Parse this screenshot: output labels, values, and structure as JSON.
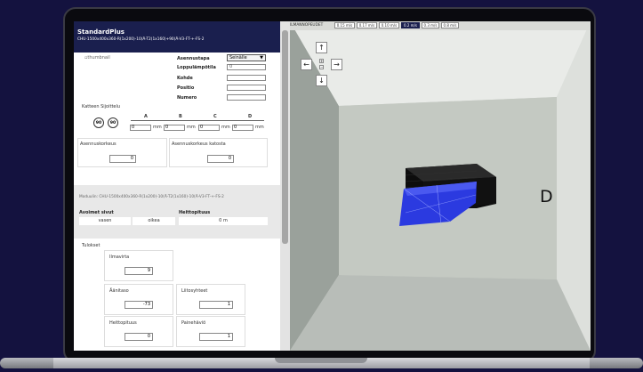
{
  "header": {
    "title": "StandardPlus",
    "product_code": "CHU-1500x400x360-R(1x200)-10(Ā-T2(1x160)+90(Ā-V3-FT-+-FS-2"
  },
  "thumbnail_alt": "thumbnail",
  "form": {
    "mounting_label": "Asennustapa",
    "mounting_value": "Seinälle",
    "final_temp_label": "Loppulämpötila",
    "final_temp_value": "0",
    "target_label": "Kohde",
    "position_label": "Positio",
    "number_label": "Numero"
  },
  "ceiling_distances_label": "Katteen Sijoittelu",
  "rotate_left_label": "90",
  "rotate_right_label": "90",
  "columns": [
    "A",
    "B",
    "C",
    "D"
  ],
  "mm_values": [
    "0",
    "0",
    "0",
    "0"
  ],
  "unit_mm": "mm",
  "install_height": {
    "label": "Asennuskorkeus",
    "value": "0"
  },
  "install_height_ceiling": {
    "label": "Asennuskorkeus katosta",
    "value": "0"
  },
  "grey_section": {
    "model_text": "Moduulin: CHU-1500x400x360-R(1x200)-10(Ā-T2(1x160)-10(Ā-V3-FT-+-FS-2",
    "open_sides_label": "Avoimet sivut",
    "side_left": "vasen",
    "side_right": "oikea",
    "throw_label": "Heittopituus",
    "throw_value": "0 m"
  },
  "results": {
    "title": "Tulokset",
    "airflow": {
      "label": "Ilmavirta",
      "value": "9"
    },
    "sound": {
      "label": "Äänitaso",
      "value": "-73"
    },
    "connections": {
      "label": "Liitosyhteet",
      "value": "1"
    },
    "throw": {
      "label": "Heittopituus",
      "value": "0"
    },
    "pressure": {
      "label": "Painehäviö",
      "value": "1"
    }
  },
  "speed_bar": {
    "label": "ILMANNOPEUDET",
    "options": [
      "0.15 m/s",
      "0.17 m/s",
      "0.10 m/s",
      "0.2 m/s",
      "0.3 m/s",
      "0.8 m/s"
    ],
    "active_index": 3
  },
  "nav": {
    "up": "↑",
    "down": "↓",
    "left": "←",
    "right": "→",
    "zoom_in": "+",
    "zoom_out": "−"
  },
  "scene_label": "D",
  "colors": {
    "header": "#1a1f4e",
    "blue_module": "#2b3ae0",
    "box": "#111111"
  }
}
